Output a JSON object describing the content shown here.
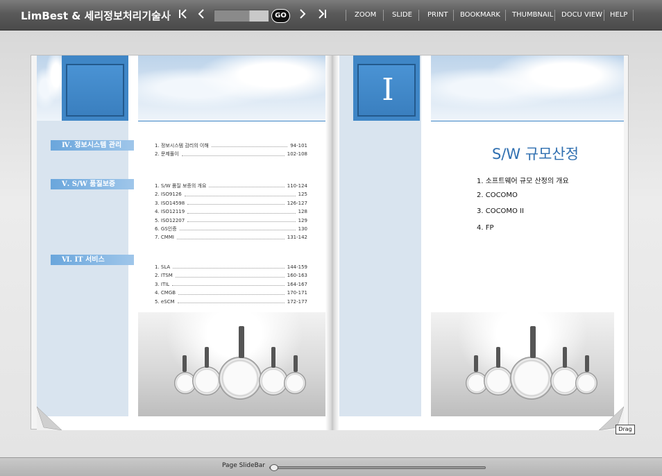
{
  "toolbar": {
    "brand": "LimBest & 세리정보처리기술사",
    "first_icon": "first-page-icon",
    "prev_icon": "prev-page-icon",
    "next_icon": "next-page-icon",
    "last_icon": "last-page-icon",
    "go_label": "GO",
    "page_input_value": "",
    "menu": [
      "ZOOM",
      "SLIDE",
      "PRINT",
      "BOOKMARK",
      "THUMBNAIL",
      "DOCU VIEW",
      "HELP"
    ]
  },
  "left_page": {
    "sections": [
      {
        "label": "Ⅳ. 정보시스템 관리"
      },
      {
        "label": "Ⅴ. S/W 품질보증"
      },
      {
        "label": "Ⅵ. IT 서비스"
      }
    ],
    "toc_groups": [
      [
        {
          "t": "1. 정보시스템 감리의 이해",
          "p": "94-101"
        },
        {
          "t": "2. 문제풀이",
          "p": "102-108"
        }
      ],
      [
        {
          "t": "1. S/W 품질 보증의 개요",
          "p": "110-124"
        },
        {
          "t": "2. ISO9126",
          "p": "125"
        },
        {
          "t": "3. ISO14598",
          "p": "126-127"
        },
        {
          "t": "4. ISO12119",
          "p": "128"
        },
        {
          "t": "5. ISO12207",
          "p": "129"
        },
        {
          "t": "6. GS인증",
          "p": "130"
        },
        {
          "t": "7. CMMI",
          "p": "131-142"
        }
      ],
      [
        {
          "t": "1. SLA",
          "p": "144-159"
        },
        {
          "t": "2. ITSM",
          "p": "160-163"
        },
        {
          "t": "3. ITIL",
          "p": "164-167"
        },
        {
          "t": "4. CMGB",
          "p": "170-171"
        },
        {
          "t": "5. eSCM",
          "p": "172-177"
        }
      ]
    ]
  },
  "right_page": {
    "roman": "I",
    "title": "S/W 규모산정",
    "items": [
      "1. 소프트웨어 규모 산정의 개요",
      "2. COCOMO",
      "3. COCOMO II",
      "4. FP"
    ]
  },
  "drag_label": "Drag",
  "slidebar": {
    "label": "Page SlideBar",
    "position": 0
  }
}
